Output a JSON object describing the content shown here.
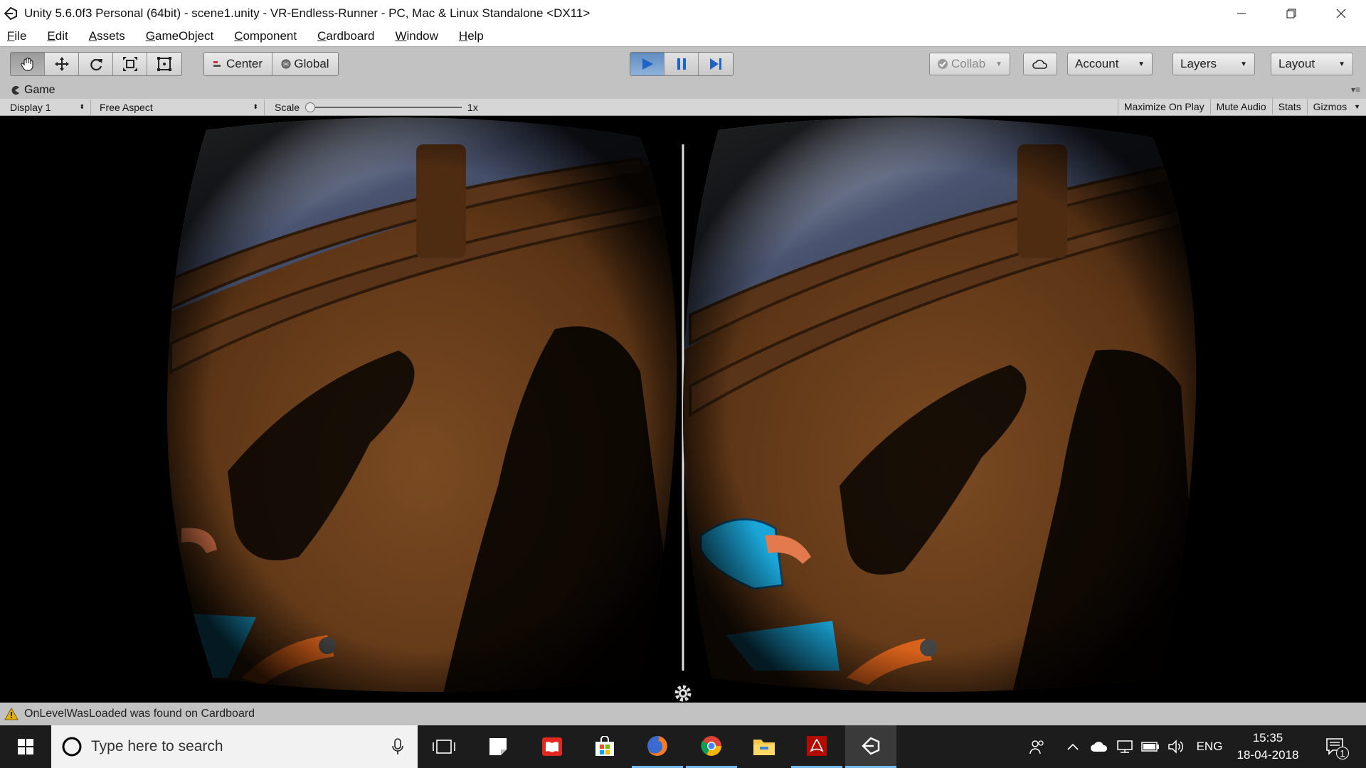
{
  "window": {
    "title": "Unity 5.6.0f3 Personal (64bit) - scene1.unity - VR-Endless-Runner - PC, Mac & Linux Standalone <DX11>"
  },
  "menu": {
    "items": [
      "File",
      "Edit",
      "Assets",
      "GameObject",
      "Component",
      "Cardboard",
      "Window",
      "Help"
    ]
  },
  "toolbar": {
    "pivot_center": "Center",
    "pivot_global": "Global",
    "collab": "Collab",
    "account": "Account",
    "layers": "Layers",
    "layout": "Layout"
  },
  "game_view": {
    "tab_label": "Game",
    "display": "Display 1",
    "aspect": "Free Aspect",
    "scale_label": "Scale",
    "scale_value": "1x",
    "maximize_on_play": "Maximize On Play",
    "mute_audio": "Mute Audio",
    "stats": "Stats",
    "gizmos": "Gizmos"
  },
  "status": {
    "message": "OnLevelWasLoaded was found on Cardboard"
  },
  "taskbar": {
    "search_placeholder": "Type here to search",
    "language": "ENG",
    "time": "15:35",
    "date": "18-04-2018",
    "notification_count": "1"
  },
  "colors": {
    "play_active": "#5f8cc0",
    "toolbar_bg": "#c2c2c2",
    "taskbar_bg": "#1c1c1c",
    "warning": "#e8b400"
  }
}
